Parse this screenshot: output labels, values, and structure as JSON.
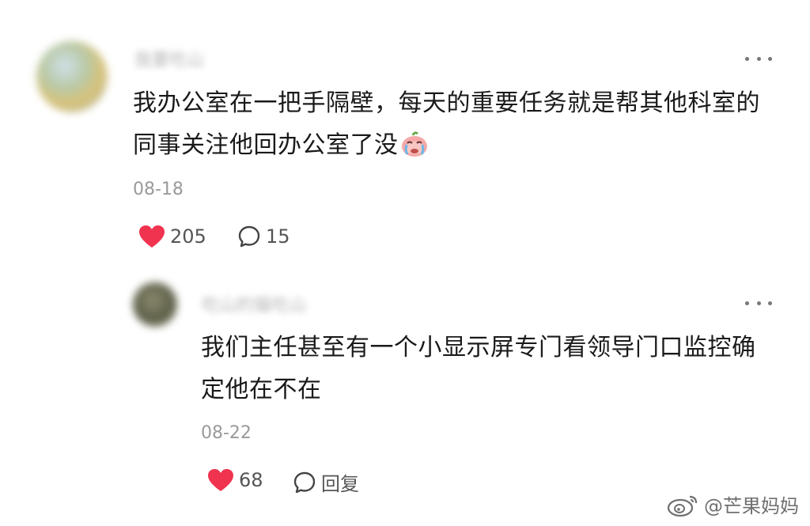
{
  "comment": {
    "username": "我要吃山",
    "text": "我办公室在一把手隔壁，每天的重要任务就是帮其他科室的同事关注他回办公室了没",
    "emoji": "crying-face-icon",
    "date": "08-18",
    "likes": "205",
    "comments": "15"
  },
  "reply": {
    "username": "吃山的猫吃山",
    "text": "我们主任甚至有一个小显示屏专门看领导门口监控确定他在不在",
    "date": "08-22",
    "likes": "68",
    "reply_label": "回复"
  },
  "watermark": {
    "text": "@芒果妈妈",
    "icon": "weibo-icon"
  },
  "colors": {
    "like_red": "#f0334f",
    "text": "#1a1a1a",
    "meta_gray": "#9a9a9a"
  }
}
